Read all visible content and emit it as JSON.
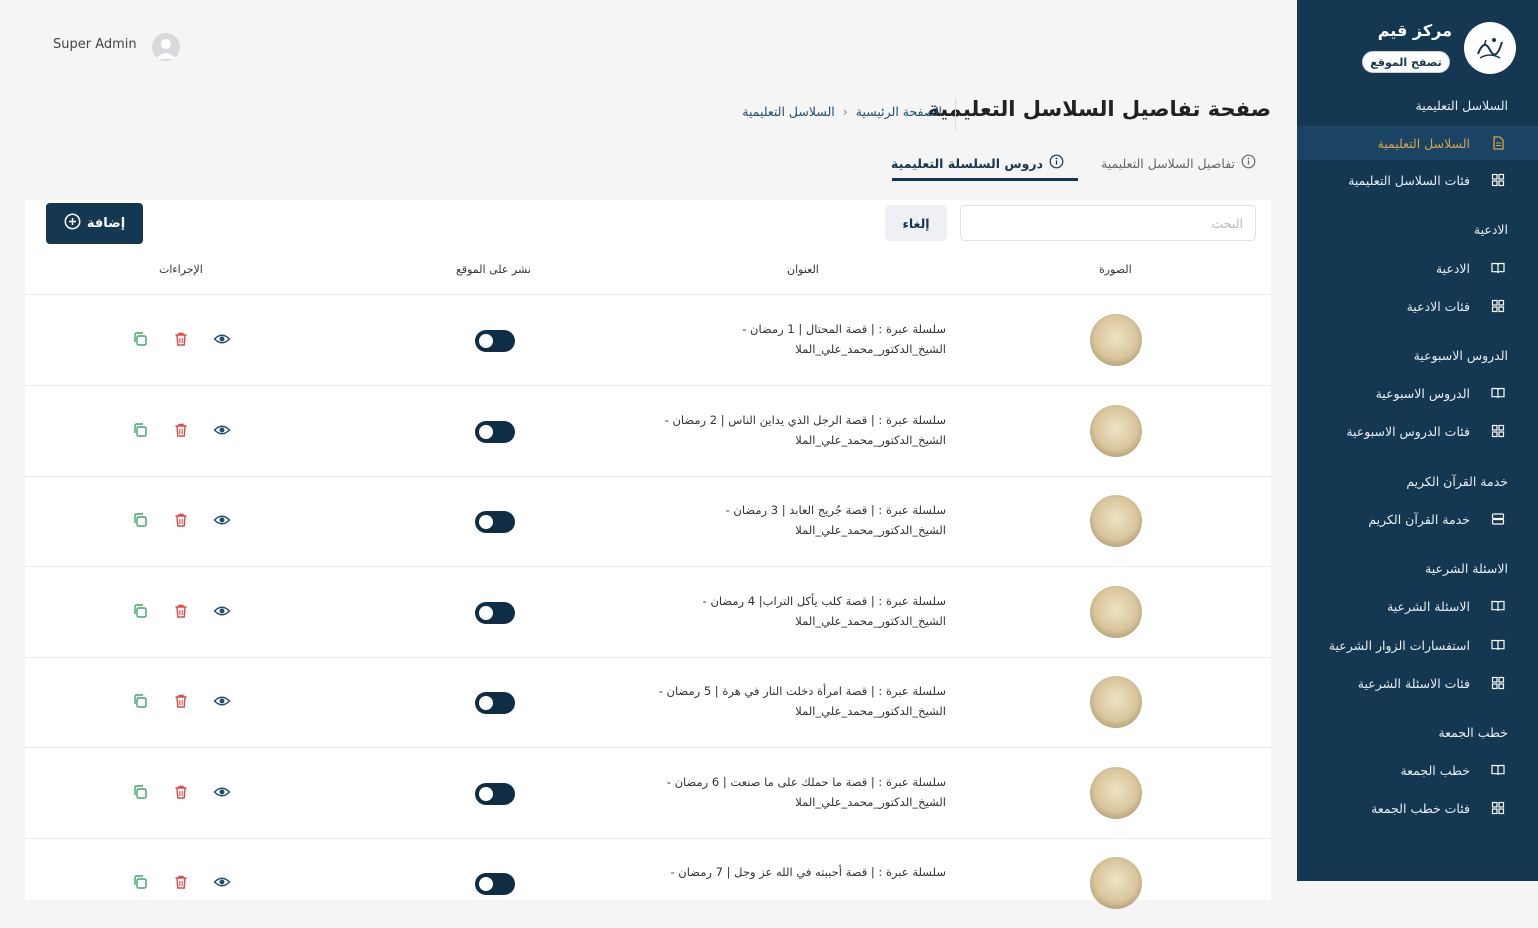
{
  "sidebar": {
    "title": "مركز قيم",
    "browse_label": "تصفح الموقع",
    "sections": [
      {
        "label": "السلاسل التعليمية"
      },
      {
        "label": "الادعية"
      },
      {
        "label": "الدروس الاسبوعية"
      },
      {
        "label": "خدمة القرآن الكريم"
      },
      {
        "label": "الاسئلة الشرعية"
      },
      {
        "label": "خطب الجمعة"
      }
    ],
    "items": [
      {
        "label": "السلاسل التعليمية",
        "icon": "document-icon",
        "active": true
      },
      {
        "label": "فئات السلاسل التعليمية",
        "icon": "grid-icon"
      },
      {
        "label": "الادعية",
        "icon": "book-icon"
      },
      {
        "label": "فئات الادعية",
        "icon": "grid-icon"
      },
      {
        "label": "الدروس الاسبوعية",
        "icon": "book-icon"
      },
      {
        "label": "فئات الدروس الاسبوعية",
        "icon": "grid-icon"
      },
      {
        "label": "خدمة القرآن الكريم",
        "icon": "server-icon"
      },
      {
        "label": "الاسئلة الشرعية",
        "icon": "book-icon"
      },
      {
        "label": "استفسارات الزوار الشرعية",
        "icon": "book-icon"
      },
      {
        "label": "فئات الاسئلة الشرعية",
        "icon": "grid-icon"
      },
      {
        "label": "خطب الجمعة",
        "icon": "book-icon"
      },
      {
        "label": "فئات خطب الجمعة",
        "icon": "grid-icon"
      }
    ]
  },
  "header": {
    "user_name": "Super Admin",
    "page_title": "صفحة تفاصيل السلاسل التعليمية",
    "breadcrumb": [
      "الصفحة الرئيسية",
      "السلاسل التعليمية"
    ]
  },
  "tabs": [
    {
      "label": "تفاصيل السلاسل التعليمية",
      "active": false
    },
    {
      "label": "دروس السلسلة التعليمية",
      "active": true
    }
  ],
  "toolbar": {
    "search_placeholder": "البحث",
    "cancel_label": "إلغاء",
    "add_label": "إضافة"
  },
  "table": {
    "columns": [
      "الصورة",
      "العنوان",
      "نشر على الموقع",
      "الإجراءات"
    ],
    "rows": [
      {
        "title_line1": "سلسلة عبرة : | قصة المحتال | 1 رمضان -",
        "title_line2": "الشيخ_الدكتور_محمد_علي_الملا",
        "published": true
      },
      {
        "title_line1": "سلسلة عبرة : | قصة الرجل الذي يداين الناس | 2 رمضان -",
        "title_line2": "الشيخ_الدكتور_محمد_علي_الملا",
        "published": true
      },
      {
        "title_line1": "سلسلة عبرة : | قصة جُريج العابد | 3 رمضان -",
        "title_line2": "الشيخ_الدكتور_محمد_علي_الملا",
        "published": true
      },
      {
        "title_line1": "سلسلة عبرة : | قصة كلب يأكل التراب| 4 رمضان -",
        "title_line2": "الشيخ_الدكتور_محمد_علي_الملا",
        "published": true
      },
      {
        "title_line1": "سلسلة عبرة : | قصة امرأة دخلت النار في هرة | 5 رمضان -",
        "title_line2": "الشيخ_الدكتور_محمد_علي_الملا",
        "published": true
      },
      {
        "title_line1": "سلسلة عبرة : | قصة ما حملك على ما صنعت | 6 رمضان -",
        "title_line2": "الشيخ_الدكتور_محمد_علي_الملا",
        "published": true
      },
      {
        "title_line1": "سلسلة عبرة : | قصة أحببته في الله عز وجل | 7 رمضان -",
        "title_line2": "",
        "published": true
      }
    ]
  },
  "colors": {
    "sidebar_bg": "#143752",
    "active_item": "#d9a34a",
    "copy_icon": "#3aa76d",
    "delete_icon": "#e04848",
    "view_icon": "#1d4f73"
  }
}
